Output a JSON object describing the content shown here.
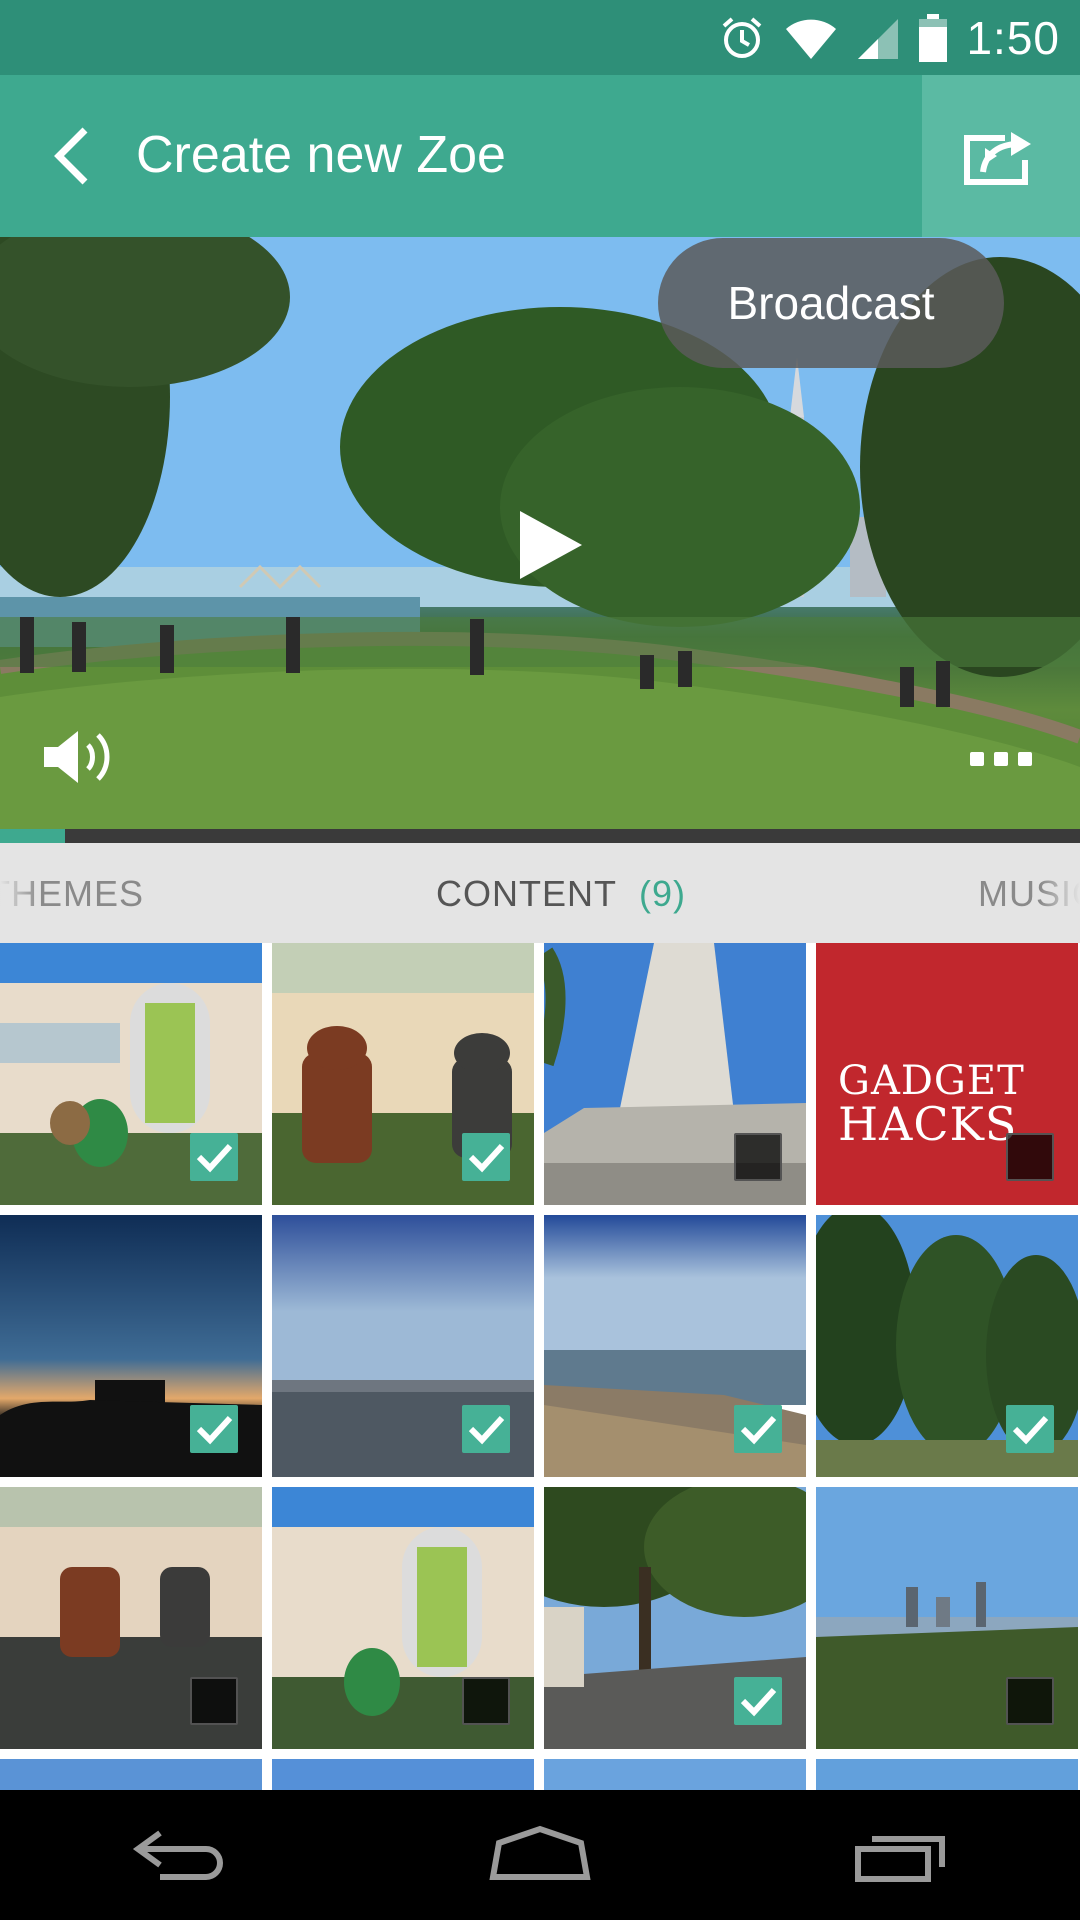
{
  "status_bar": {
    "time": "1:50"
  },
  "header": {
    "title": "Create new Zoe"
  },
  "video": {
    "overlay_button": "Broadcast",
    "progress": 0.06
  },
  "tabs": {
    "left": "THEMES",
    "center": "CONTENT",
    "center_count": "(9)",
    "right": "MUSIC"
  },
  "gadget_hacks": {
    "line1": "GADGET",
    "line2": "HACKS"
  },
  "grid": {
    "items": [
      {
        "checked": true
      },
      {
        "checked": true
      },
      {
        "checked": false
      },
      {
        "checked": false
      },
      {
        "checked": true
      },
      {
        "checked": true
      },
      {
        "checked": true
      },
      {
        "checked": true
      },
      {
        "checked": false
      },
      {
        "checked": false
      },
      {
        "checked": true
      },
      {
        "checked": false
      }
    ]
  },
  "colors": {
    "accent": "#3ea98f",
    "status_bar": "#2e8f78",
    "checkbox_on": "#46b196"
  }
}
